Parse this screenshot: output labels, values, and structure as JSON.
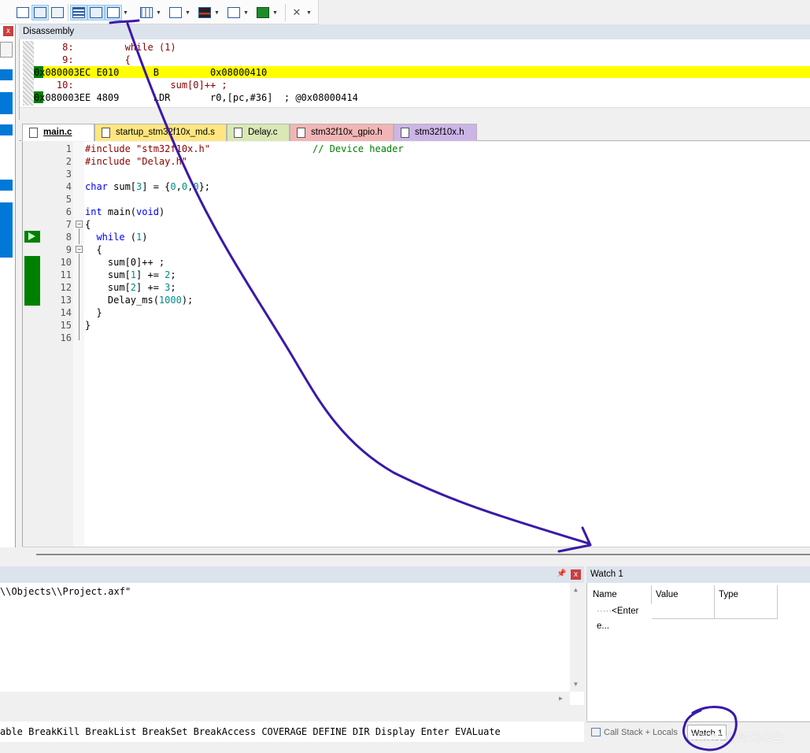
{
  "toolbar": {
    "buttons": [
      {
        "name": "command-window-button",
        "icon": "command-window-icon"
      },
      {
        "name": "disassembly-window-button",
        "icon": "disassembly-icon"
      },
      {
        "name": "symbols-window-button",
        "icon": "symbols-icon"
      },
      {
        "name": "registers-window-button",
        "icon": "registers-icon"
      },
      {
        "name": "call-stack-window-button",
        "icon": "call-stack-icon"
      },
      {
        "name": "watch-windows-button",
        "icon": "watch-icon"
      },
      {
        "name": "memory-windows-button",
        "icon": "memory-icon"
      },
      {
        "name": "serial-windows-button",
        "icon": "serial-icon"
      },
      {
        "name": "analysis-windows-button",
        "icon": "logic-analyzer-icon"
      },
      {
        "name": "trace-windows-button",
        "icon": "trace-icon"
      },
      {
        "name": "system-viewer-button",
        "icon": "system-viewer-icon"
      },
      {
        "name": "toolbox-button",
        "icon": "tools-icon"
      }
    ]
  },
  "disassembly": {
    "title": "Disassembly",
    "lines": [
      {
        "addr": "",
        "text": "     8:         while (1)"
      },
      {
        "addr": "",
        "text": "     9:         {"
      },
      {
        "addr": "",
        "text": "0x080003EC E010      B         0x08000410"
      },
      {
        "addr": "",
        "text": "    10:                 sum[0]++ ;"
      },
      {
        "addr": "",
        "text": "0x080003EE 4809      LDR       r0,[pc,#36]  ; @0x08000414"
      }
    ]
  },
  "tabs": [
    {
      "label": "main.c",
      "color": "#ffffff",
      "active": true
    },
    {
      "label": "startup_stm32f10x_md.s",
      "color": "#ffe680",
      "active": false
    },
    {
      "label": "Delay.c",
      "color": "#d9e8b5",
      "active": false
    },
    {
      "label": "stm32f10x_gpio.h",
      "color": "#f2b5b5",
      "active": false
    },
    {
      "label": "stm32f10x.h",
      "color": "#cbb5e6",
      "active": false
    }
  ],
  "editor": {
    "line_numbers": [
      "1",
      "2",
      "3",
      "4",
      "5",
      "6",
      "7",
      "8",
      "9",
      "10",
      "11",
      "12",
      "13",
      "14",
      "15",
      "16"
    ],
    "line1_a": "#include ",
    "line1_b": "\"stm32f10x.h\"",
    "line1_c": "                  // Device header",
    "line2_a": "#include ",
    "line2_b": "\"Delay.h\"",
    "line4_a": "char",
    "line4_b": " sum[",
    "line4_c": "3",
    "line4_d": "] = {",
    "line4_e": "0",
    "line4_f": ",",
    "line4_g": "0",
    "line4_h": ",",
    "line4_i": "0",
    "line4_j": "};",
    "line6_a": "int",
    "line6_b": " main(",
    "line6_c": "void",
    "line6_d": ")",
    "line7": "{",
    "line8_a": "  ",
    "line8_b": "while",
    "line8_c": " (",
    "line8_d": "1",
    "line8_e": ")",
    "line9": "  {",
    "line10": "    sum[0]++ ;",
    "line11_a": "    sum[",
    "line11_b": "1",
    "line11_c": "] += ",
    "line11_d": "2",
    "line11_e": ";",
    "line12_a": "    sum[",
    "line12_b": "2",
    "line12_c": "] += ",
    "line12_d": "3",
    "line12_e": ";",
    "line13_a": "    Delay_ms(",
    "line13_b": "1000",
    "line13_c": ");",
    "line14": "  }",
    "line15": "}"
  },
  "command": {
    "output": "\\\\Objects\\\\Project.axf\"",
    "line": "able BreakKill BreakList BreakSet BreakAccess COVERAGE DEFINE DIR Display Enter EVALuate",
    "pin_icon": "pin-icon"
  },
  "watch": {
    "title": "Watch 1",
    "columns": [
      "Name",
      "Value",
      "Type"
    ],
    "row_name": "<Enter e...",
    "tab_callstack": "Call Stack + Locals",
    "tab_watch": "Watch 1"
  },
  "watermark": "CSDN @时光の尘",
  "annotation_color": "#3a1aa8"
}
